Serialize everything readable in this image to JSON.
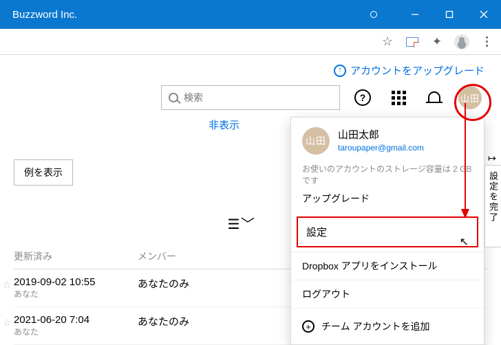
{
  "window": {
    "title": "Buzzword Inc."
  },
  "browser": {},
  "banner": {
    "upgrade_text": "アカウントをアップグレード"
  },
  "search": {
    "placeholder": "検索"
  },
  "content": {
    "hide_label": "非表示",
    "example_button": "例を表示",
    "columns": {
      "updated": "更新済み",
      "members": "メンバー"
    },
    "rows": [
      {
        "datetime": "2019-09-02 10:55",
        "owner": "あなた",
        "members": "あなたのみ"
      },
      {
        "datetime": "2021-06-20 7:04",
        "owner": "あなた",
        "members": "あなたのみ"
      }
    ]
  },
  "menu": {
    "avatar_text": "山田",
    "name": "山田太郎",
    "email": "taroupaper@gmail.com",
    "storage_text": "お使いのアカウントのストレージ容量は 2 GB です",
    "upgrade": "アップグレード",
    "settings": "設定",
    "install": "Dropbox アプリをインストール",
    "logout": "ログアウト",
    "add_team": "チーム アカウントを追加"
  },
  "sidetab": {
    "label": "設定を完了"
  }
}
